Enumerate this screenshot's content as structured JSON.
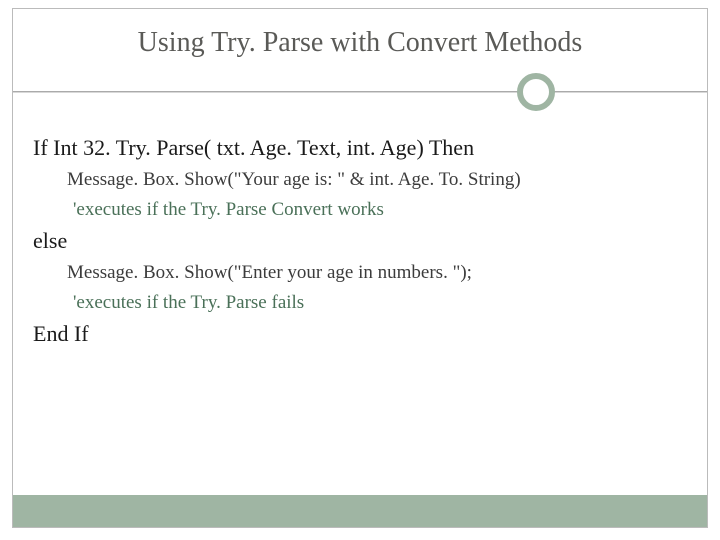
{
  "slide": {
    "title": "Using Try. Parse with Convert Methods",
    "code": {
      "line1": "If Int 32. Try. Parse( txt. Age. Text, int. Age) Then",
      "line2": "Message. Box. Show(\"Your age is: \" &  int. Age. To. String)",
      "line3": "'executes if the Try. Parse Convert works",
      "line4": "else",
      "line5": "Message. Box. Show(\"Enter your age in numbers. \");",
      "line6": "'executes if the Try. Parse fails",
      "line7": "End If"
    }
  },
  "colors": {
    "accent": "#9fb5a3",
    "title": "#5a5a57",
    "comment": "#4a7058"
  }
}
